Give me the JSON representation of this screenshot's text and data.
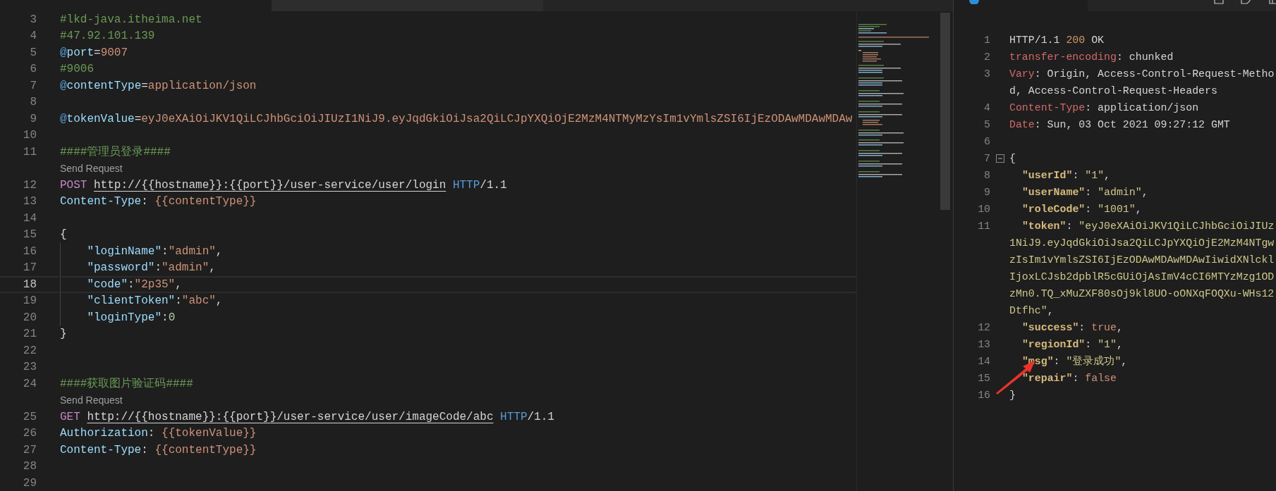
{
  "editor": {
    "lines": [
      {
        "number": "3",
        "current": false,
        "tokens": [
          {
            "kind": "comment",
            "text": "#lkd-java.itheima.net"
          }
        ]
      },
      {
        "number": "4",
        "current": false,
        "tokens": [
          {
            "kind": "comment",
            "text": "#47.92.101.139"
          }
        ]
      },
      {
        "number": "5",
        "current": false,
        "tokens": [
          {
            "kind": "at",
            "text": "@"
          },
          {
            "kind": "var",
            "text": "port"
          },
          {
            "kind": "text",
            "text": "="
          },
          {
            "kind": "value",
            "text": "9007"
          }
        ]
      },
      {
        "number": "6",
        "current": false,
        "tokens": [
          {
            "kind": "comment",
            "text": "#9006"
          }
        ]
      },
      {
        "number": "7",
        "current": false,
        "tokens": [
          {
            "kind": "at",
            "text": "@"
          },
          {
            "kind": "var",
            "text": "contentType"
          },
          {
            "kind": "text",
            "text": "="
          },
          {
            "kind": "value",
            "text": "application/json"
          }
        ]
      },
      {
        "number": "8",
        "current": false
      },
      {
        "number": "9",
        "current": false,
        "tokens": [
          {
            "kind": "at",
            "text": "@"
          },
          {
            "kind": "var",
            "text": "tokenValue"
          },
          {
            "kind": "text",
            "text": "="
          },
          {
            "kind": "value",
            "text": "eyJ0eXAiOiJKV1QiLCJhbGciOiJIUzI1NiJ9.eyJqdGkiOiJsa2QiLCJpYXQiOjE2MzM4NTMyMzYsIm1vYmlsZSI6IjEzODAwMDAwMDAw"
          }
        ]
      },
      {
        "number": "10",
        "current": false
      },
      {
        "number": "11",
        "current": false,
        "tokens": [
          {
            "kind": "comment",
            "text": "####管理员登录####"
          }
        ]
      },
      {
        "kind": "codelens",
        "text": "Send Request"
      },
      {
        "number": "12",
        "current": false,
        "tokens": [
          {
            "kind": "method",
            "text": "POST"
          },
          {
            "kind": "url",
            "text": "http://{{hostname}}:{{port}}/user-service/user/login"
          },
          {
            "kind": "proto",
            "text": "HTTP"
          },
          {
            "kind": "text",
            "text": "/1.1"
          }
        ]
      },
      {
        "number": "13",
        "current": false,
        "tokens": [
          {
            "kind": "var",
            "text": "Content-Type"
          },
          {
            "kind": "text",
            "text": ": "
          },
          {
            "kind": "value",
            "text": "{{contentType}}"
          }
        ]
      },
      {
        "number": "14",
        "current": false
      },
      {
        "number": "15",
        "current": false,
        "tokens": [
          {
            "kind": "text",
            "text": "{"
          }
        ],
        "children": [
          {
            "number": "16",
            "current": false,
            "tokens": [
              {
                "kind": "var",
                "text": "\"loginName\""
              },
              {
                "kind": "text",
                "text": ":"
              },
              {
                "kind": "value",
                "text": "\"admin\""
              },
              {
                "kind": "text",
                "text": ","
              }
            ]
          },
          {
            "number": "17",
            "current": false,
            "tokens": [
              {
                "kind": "var",
                "text": "\"password\""
              },
              {
                "kind": "text",
                "text": ":"
              },
              {
                "kind": "value",
                "text": "\"admin\""
              },
              {
                "kind": "text",
                "text": ","
              }
            ]
          },
          {
            "number": "18",
            "current": true,
            "tokens": [
              {
                "kind": "var",
                "text": "\"code\""
              },
              {
                "kind": "text",
                "text": ":"
              },
              {
                "kind": "value",
                "text": "\"2p35\""
              },
              {
                "kind": "text",
                "text": ","
              }
            ]
          },
          {
            "number": "19",
            "current": false,
            "tokens": [
              {
                "kind": "var",
                "text": "\"clientToken\""
              },
              {
                "kind": "text",
                "text": ":"
              },
              {
                "kind": "value",
                "text": "\"abc\""
              },
              {
                "kind": "text",
                "text": ","
              }
            ]
          },
          {
            "number": "20",
            "current": false,
            "tokens": [
              {
                "kind": "var",
                "text": "\"loginType\""
              },
              {
                "kind": "text",
                "text": ":"
              },
              {
                "kind": "number",
                "text": "0"
              }
            ]
          }
        ]
      },
      {
        "number": "21",
        "current": false,
        "tokens": [
          {
            "kind": "text",
            "text": "}"
          }
        ]
      },
      {
        "number": "22",
        "current": false
      },
      {
        "number": "23",
        "current": false
      },
      {
        "number": "24",
        "current": false,
        "tokens": [
          {
            "kind": "comment",
            "text": "####获取图片验证码####"
          }
        ]
      },
      {
        "kind": "codelens",
        "text": "Send Request"
      },
      {
        "number": "25",
        "current": false,
        "tokens": [
          {
            "kind": "method",
            "text": "GET"
          },
          {
            "kind": "url",
            "text": "http://{{hostname}}:{{port}}/user-service/user/imageCode/abc"
          },
          {
            "kind": "proto",
            "text": "HTTP"
          },
          {
            "kind": "text",
            "text": "/1.1"
          }
        ]
      },
      {
        "number": "26",
        "current": false,
        "tokens": [
          {
            "kind": "var",
            "text": "Authorization"
          },
          {
            "kind": "text",
            "text": ": "
          },
          {
            "kind": "value",
            "text": "{{tokenValue}}"
          }
        ]
      },
      {
        "number": "27",
        "current": false,
        "tokens": [
          {
            "kind": "var",
            "text": "Content-Type"
          },
          {
            "kind": "text",
            "text": ": "
          },
          {
            "kind": "value",
            "text": "{{contentType}}"
          }
        ]
      },
      {
        "number": "28",
        "current": false
      },
      {
        "number": "29",
        "current": false
      }
    ]
  },
  "response": {
    "lines": [
      {
        "number": "1",
        "tokens": [
          {
            "kind": "text",
            "text": "HTTP/1.1 "
          },
          {
            "kind": "status",
            "text": "200"
          },
          {
            "kind": "text",
            "text": " OK"
          }
        ]
      },
      {
        "number": "2",
        "tokens": [
          {
            "kind": "header",
            "text": "transfer-encoding"
          },
          {
            "kind": "text",
            "text": ": chunked"
          }
        ]
      },
      {
        "number": "3",
        "tokens": [
          {
            "kind": "header",
            "text": "Vary"
          },
          {
            "kind": "text",
            "text": ": Origin, Access-Control-Request-Metho"
          }
        ],
        "wrap": [
          [
            {
              "kind": "text",
              "text": "d, Access-Control-Request-Headers"
            }
          ]
        ]
      },
      {
        "number": "4",
        "tokens": [
          {
            "kind": "header",
            "text": "Content-Type"
          },
          {
            "kind": "text",
            "text": ": application/json"
          }
        ]
      },
      {
        "number": "5",
        "tokens": [
          {
            "kind": "header",
            "text": "Date"
          },
          {
            "kind": "text",
            "text": ": Sun, 03 Oct 2021 09:27:12 GMT"
          }
        ]
      },
      {
        "number": "6"
      },
      {
        "number": "7",
        "expanded": true,
        "tokens": [
          {
            "kind": "text",
            "text": "{"
          }
        ],
        "children": [
          {
            "number": "8",
            "tokens": [
              {
                "kind": "key",
                "text": "\"userId\""
              },
              {
                "kind": "text",
                "text": ": "
              },
              {
                "kind": "string",
                "text": "\"1\""
              },
              {
                "kind": "text",
                "text": ","
              }
            ]
          },
          {
            "number": "9",
            "tokens": [
              {
                "kind": "key",
                "text": "\"userName\""
              },
              {
                "kind": "text",
                "text": ": "
              },
              {
                "kind": "string",
                "text": "\"admin\""
              },
              {
                "kind": "text",
                "text": ","
              }
            ]
          },
          {
            "number": "10",
            "tokens": [
              {
                "kind": "key",
                "text": "\"roleCode\""
              },
              {
                "kind": "text",
                "text": ": "
              },
              {
                "kind": "string",
                "text": "\"1001\""
              },
              {
                "kind": "text",
                "text": ","
              }
            ]
          },
          {
            "number": "11",
            "tokens": [
              {
                "kind": "key",
                "text": "\"token\""
              },
              {
                "kind": "text",
                "text": ": "
              },
              {
                "kind": "string",
                "text": "\"eyJ0eXAiOiJKV1QiLCJhbGciOiJIUz"
              }
            ],
            "wrap": [
              [
                {
                  "kind": "string",
                  "text": "1NiJ9.eyJqdGkiOiJsa2QiLCJpYXQiOjE2MzM4NTgw"
                }
              ],
              [
                {
                  "kind": "string",
                  "text": "zIsIm1vYmlsZSI6IjEzODAwMDAwMDAwIiwidXNlckl"
                }
              ],
              [
                {
                  "kind": "string",
                  "text": "IjoxLCJsb2dpblR5cGUiOjAsImV4cCI6MTYzMzg1OD"
                }
              ],
              [
                {
                  "kind": "string",
                  "text": "zMn0.TQ_xMuZXF80sOj9kl8UO-oONXqFOQXu-WHs12"
                }
              ],
              [
                {
                  "kind": "string",
                  "text": "Dtfhc\""
                },
                {
                  "kind": "text",
                  "text": ","
                }
              ]
            ]
          },
          {
            "number": "12",
            "tokens": [
              {
                "kind": "key",
                "text": "\"success\""
              },
              {
                "kind": "text",
                "text": ": "
              },
              {
                "kind": "literal",
                "text": "true"
              },
              {
                "kind": "text",
                "text": ","
              }
            ]
          },
          {
            "number": "13",
            "tokens": [
              {
                "kind": "key",
                "text": "\"regionId\""
              },
              {
                "kind": "text",
                "text": ": "
              },
              {
                "kind": "string",
                "text": "\"1\""
              },
              {
                "kind": "text",
                "text": ","
              }
            ]
          },
          {
            "number": "14",
            "tokens": [
              {
                "kind": "key",
                "text": "\"msg\""
              },
              {
                "kind": "text",
                "text": ": "
              },
              {
                "kind": "string",
                "text": "\"登录成功\""
              },
              {
                "kind": "text",
                "text": ","
              }
            ]
          },
          {
            "number": "15",
            "tokens": [
              {
                "kind": "key",
                "text": "\"repair\""
              },
              {
                "kind": "text",
                "text": ": "
              },
              {
                "kind": "literal",
                "text": "false"
              }
            ]
          }
        ]
      },
      {
        "number": "16",
        "tokens": [
          {
            "kind": "text",
            "text": "}"
          }
        ]
      }
    ]
  }
}
